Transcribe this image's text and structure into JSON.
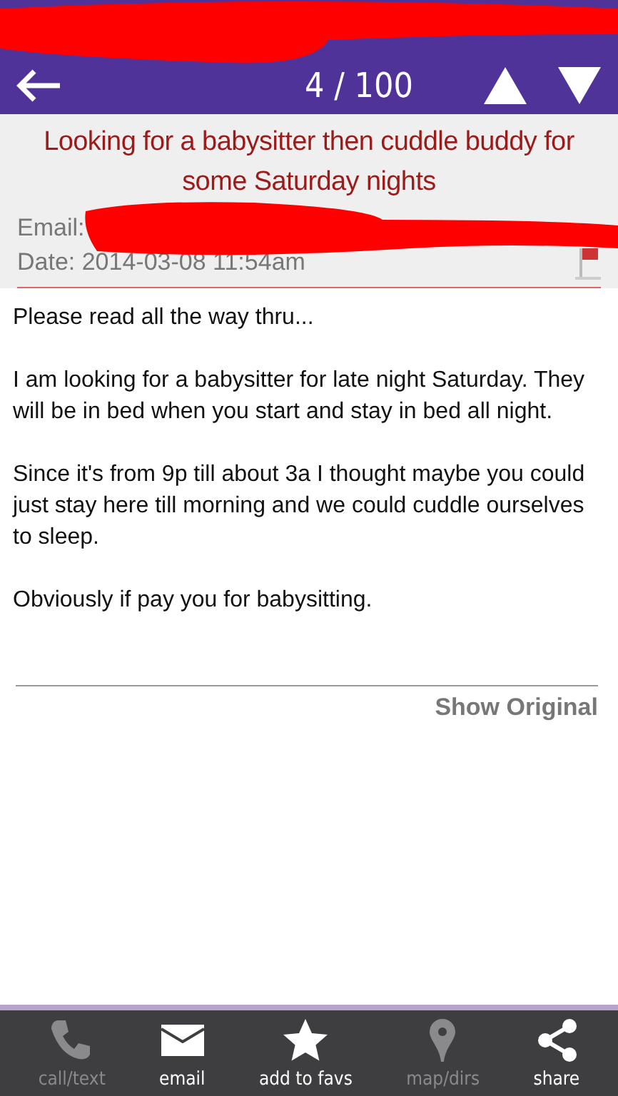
{
  "nav": {
    "counter": "4 / 100"
  },
  "post": {
    "title": "Looking for a babysitter then cuddle buddy for some Saturday nights",
    "email_label": "Email:",
    "date": "Date: 2014-03-08 11:54am"
  },
  "body": [
    "Please read all the way thru...",
    "I am looking for a babysitter for late night Saturday. They will be in bed when you start and stay in bed all night.",
    "Since it's from 9p till about 3a I thought maybe you could just stay here till morning and we could cuddle ourselves to sleep.",
    "Obviously if pay you for babysitting."
  ],
  "show_original": "Show Original",
  "toolbar": [
    {
      "kind": "phone",
      "label": "call/text",
      "disabled": true
    },
    {
      "kind": "mail",
      "label": "email",
      "disabled": false
    },
    {
      "kind": "star",
      "label": "add to favs",
      "disabled": false
    },
    {
      "kind": "pin",
      "label": "map/dirs",
      "disabled": true
    },
    {
      "kind": "share",
      "label": "share",
      "disabled": false
    }
  ]
}
